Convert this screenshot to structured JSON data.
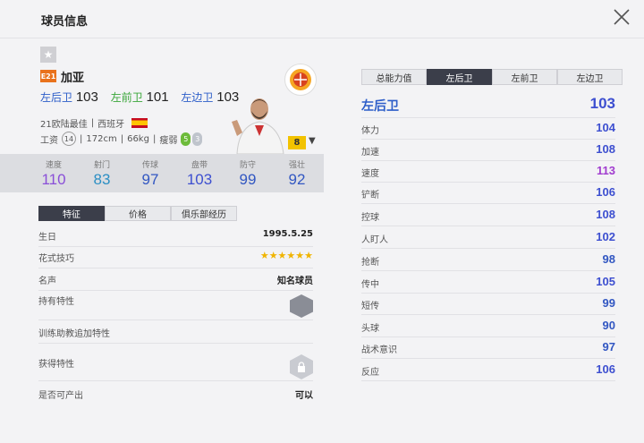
{
  "window": {
    "title": "球员信息"
  },
  "player": {
    "season_badge": "E21",
    "name": "加亚",
    "positions": [
      {
        "label": "左后卫",
        "value": "103",
        "color": "#2d5ec9"
      },
      {
        "label": "左前卫",
        "value": "101",
        "color": "#3aa63a"
      },
      {
        "label": "左边卫",
        "value": "103",
        "color": "#2d5ec9"
      }
    ],
    "honor": "21欧陆最佳",
    "nationality": "西班牙",
    "salary_label": "工资",
    "salary": "14",
    "height": "172cm",
    "weight": "66kg",
    "build": "瘦弱",
    "weak_foot_left": "5",
    "weak_foot_right": "3",
    "level": "8"
  },
  "stats": [
    {
      "label": "速度",
      "value": "110",
      "color": "#8a4fd8"
    },
    {
      "label": "射门",
      "value": "83",
      "color": "#2c8fc4"
    },
    {
      "label": "传球",
      "value": "97",
      "color": "#3257c2"
    },
    {
      "label": "盘带",
      "value": "103",
      "color": "#3d4fd0"
    },
    {
      "label": "防守",
      "value": "99",
      "color": "#3257c2"
    },
    {
      "label": "强壮",
      "value": "92",
      "color": "#3257c2"
    }
  ],
  "left_tabs": [
    "特征",
    "价格",
    "俱乐部经历"
  ],
  "traits": {
    "birthday_label": "生日",
    "birthday": "1995.5.25",
    "skill_moves_label": "花式技巧",
    "skill_stars": "★★★★★★",
    "reputation_label": "名声",
    "reputation": "知名球员",
    "traits_label": "持有特性",
    "coach_traits_label": "训练助教追加特性",
    "acquired_label": "获得特性",
    "producible_label": "是否可产出",
    "producible": "可以"
  },
  "right_tabs": [
    "总能力值",
    "左后卫",
    "左前卫",
    "左边卫"
  ],
  "detail": {
    "position": "左后卫",
    "position_value": "103",
    "rows": [
      {
        "label": "体力",
        "value": "104",
        "color": "#3d4fd0"
      },
      {
        "label": "加速",
        "value": "108",
        "color": "#3d4fd0"
      },
      {
        "label": "速度",
        "value": "113",
        "color": "#a13ccf"
      },
      {
        "label": "铲断",
        "value": "106",
        "color": "#3d4fd0"
      },
      {
        "label": "控球",
        "value": "108",
        "color": "#3d4fd0"
      },
      {
        "label": "人盯人",
        "value": "102",
        "color": "#3d4fd0"
      },
      {
        "label": "抢断",
        "value": "98",
        "color": "#3257c2"
      },
      {
        "label": "传中",
        "value": "105",
        "color": "#3d4fd0"
      },
      {
        "label": "短传",
        "value": "99",
        "color": "#3257c2"
      },
      {
        "label": "头球",
        "value": "90",
        "color": "#3257c2"
      },
      {
        "label": "战术意识",
        "value": "97",
        "color": "#3257c2"
      },
      {
        "label": "反应",
        "value": "106",
        "color": "#3d4fd0"
      }
    ]
  }
}
